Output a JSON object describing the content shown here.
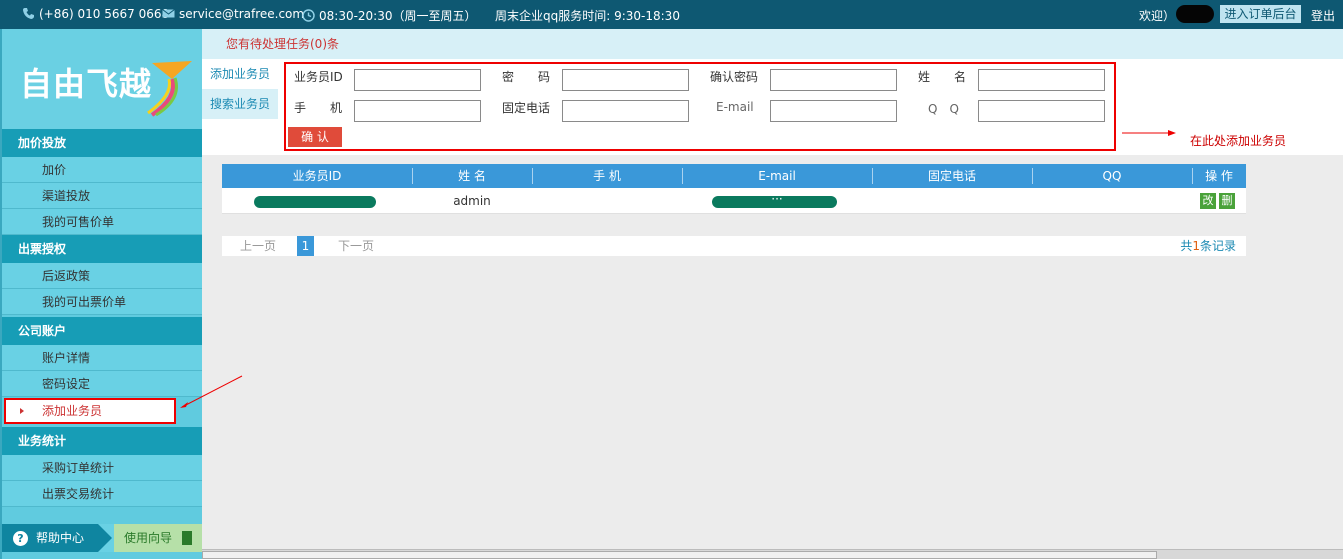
{
  "topbar": {
    "phone": "(+86) 010 5667 0668",
    "email": "service@trafree.com",
    "hours": "08:30-20:30（周一至周五）",
    "weekend_qq": "周末企业qq服务时间: 9:30-18:30",
    "welcome": "欢迎）",
    "enter_backend": "进入订单后台",
    "logout": "登出"
  },
  "logo": {
    "text": "自由飞越"
  },
  "sidebar": {
    "sections": [
      {
        "title": "加价投放",
        "items": [
          "加价",
          "渠道投放",
          "我的可售价单"
        ]
      },
      {
        "title": "出票授权",
        "items": [
          "后返政策",
          "我的可出票价单"
        ]
      },
      {
        "title": "公司账户",
        "items": [
          "账户详情",
          "密码设定",
          "添加业务员"
        ]
      },
      {
        "title": "业务统计",
        "items": [
          "采购订单统计",
          "出票交易统计"
        ]
      }
    ],
    "help": "帮助中心",
    "guide": "使用向导"
  },
  "pending": "您有待处理任务(0)条",
  "tabs": {
    "add": "添加业务员",
    "search": "搜索业务员"
  },
  "form": {
    "id_label": "业务员ID",
    "pwd_label": "密　　码",
    "confirm_pwd_label": "确认密码",
    "name_label": "姓　　名",
    "mobile_label": "手　　机",
    "phone_label": "固定电话",
    "email_label": "E-mail",
    "qq_label": "Q　Q",
    "submit": "确 认"
  },
  "annotation": "在此处添加业务员",
  "table": {
    "headers": [
      "业务员ID",
      "姓 名",
      "手 机",
      "E-mail",
      "固定电话",
      "QQ",
      "操 作"
    ],
    "rows": [
      {
        "name": "admin",
        "email_hint": "···",
        "edit": "改",
        "delete": "删"
      }
    ]
  },
  "pager": {
    "prev": "上一页",
    "current": "1",
    "next": "下一页",
    "total_prefix": "共",
    "total_count": "1",
    "total_suffix": "条记录"
  }
}
